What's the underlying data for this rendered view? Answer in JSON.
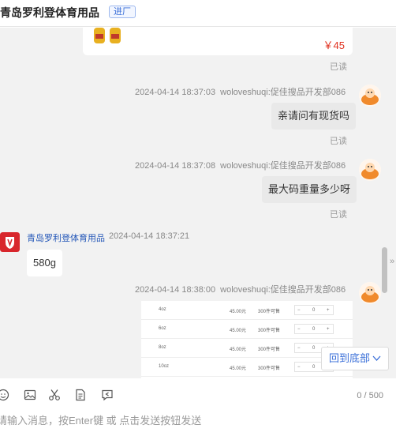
{
  "header": {
    "title": "青岛罗利登体育用品",
    "badge": "进厂"
  },
  "product_card": {
    "price": "￥45"
  },
  "messages": [
    {
      "read": "已读"
    },
    {
      "time": "2024-04-14 18:37:03",
      "nick": "woloveshuqi:促佳搜品开发部086",
      "text": "亲请问有现货吗",
      "read": "已读"
    },
    {
      "time": "2024-04-14 18:37:08",
      "nick": "woloveshuqi:促佳搜品开发部086",
      "text": "最大码重量多少呀",
      "read": "已读"
    },
    {
      "shop": "青岛罗利登体育用品",
      "time": "2024-04-14 18:37:21",
      "text": "580g"
    },
    {
      "time": "2024-04-14 18:38:00",
      "nick": "woloveshuqi:促佳搜品开发部086"
    }
  ],
  "table_image": {
    "rows": [
      {
        "size": "4oz",
        "price": "45.00元",
        "stock": "300件可售",
        "qty": "0"
      },
      {
        "size": "6oz",
        "price": "45.00元",
        "stock": "300件可售",
        "qty": "0"
      },
      {
        "size": "8oz",
        "price": "45.00元",
        "stock": "300件可售",
        "qty": "0"
      },
      {
        "size": "10oz",
        "price": "45.00元",
        "stock": "300件可售",
        "qty": "0"
      }
    ]
  },
  "back_to_bottom": "回到底部",
  "scroll_arrow": "»",
  "toolbar": {
    "counter": "0 / 500"
  },
  "input": {
    "placeholder": "请输入消息，按Enter键 或 点击发送按钮发送"
  },
  "colors": {
    "link_blue": "#3a6fd8",
    "price_red": "#e0301e",
    "chat_bg": "#f2f2f2",
    "bubble_gray": "#e9e9e9"
  }
}
